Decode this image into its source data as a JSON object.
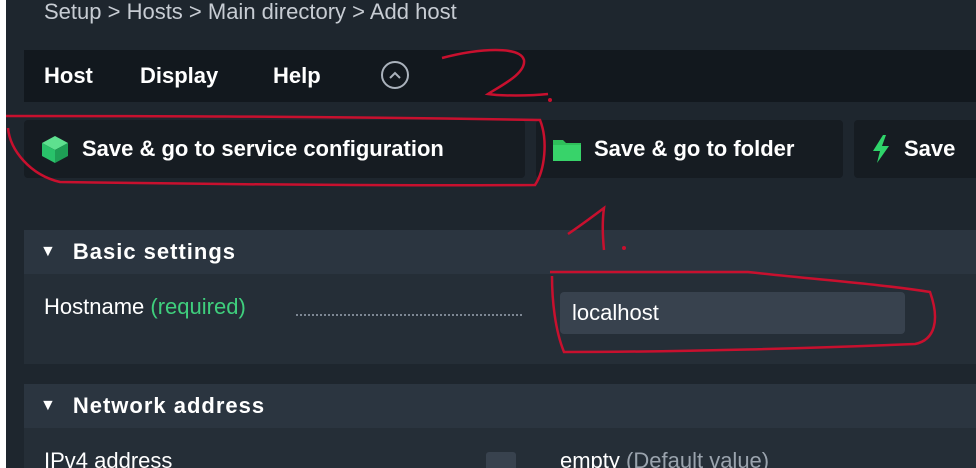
{
  "breadcrumb": "Setup > Hosts > Main directory > Add host",
  "menu": {
    "items": [
      "Host",
      "Display",
      "Help"
    ]
  },
  "buttons": {
    "save_service": "Save & go to service configuration",
    "save_folder": "Save & go to folder",
    "save": "Save"
  },
  "sections": {
    "basic": {
      "title": "Basic settings",
      "hostname_label": "Hostname",
      "hostname_required": "(required)",
      "hostname_value": "localhost"
    },
    "network": {
      "title": "Network address",
      "ipv4_label": "IPv4 address",
      "ipv4_value": "empty",
      "ipv4_default": "(Default value)"
    }
  },
  "annotations": [
    "1.",
    "2."
  ],
  "colors": {
    "annotation": "#c8102e",
    "required": "#3fcf7d",
    "service_icon": "#29c26a",
    "folder_icon": "#2fbf5a",
    "bolt_icon": "#2fd46a"
  },
  "icons": [
    "cube-icon",
    "folder-icon",
    "lightning-icon",
    "chevron-up-icon",
    "triangle-down-icon"
  ]
}
